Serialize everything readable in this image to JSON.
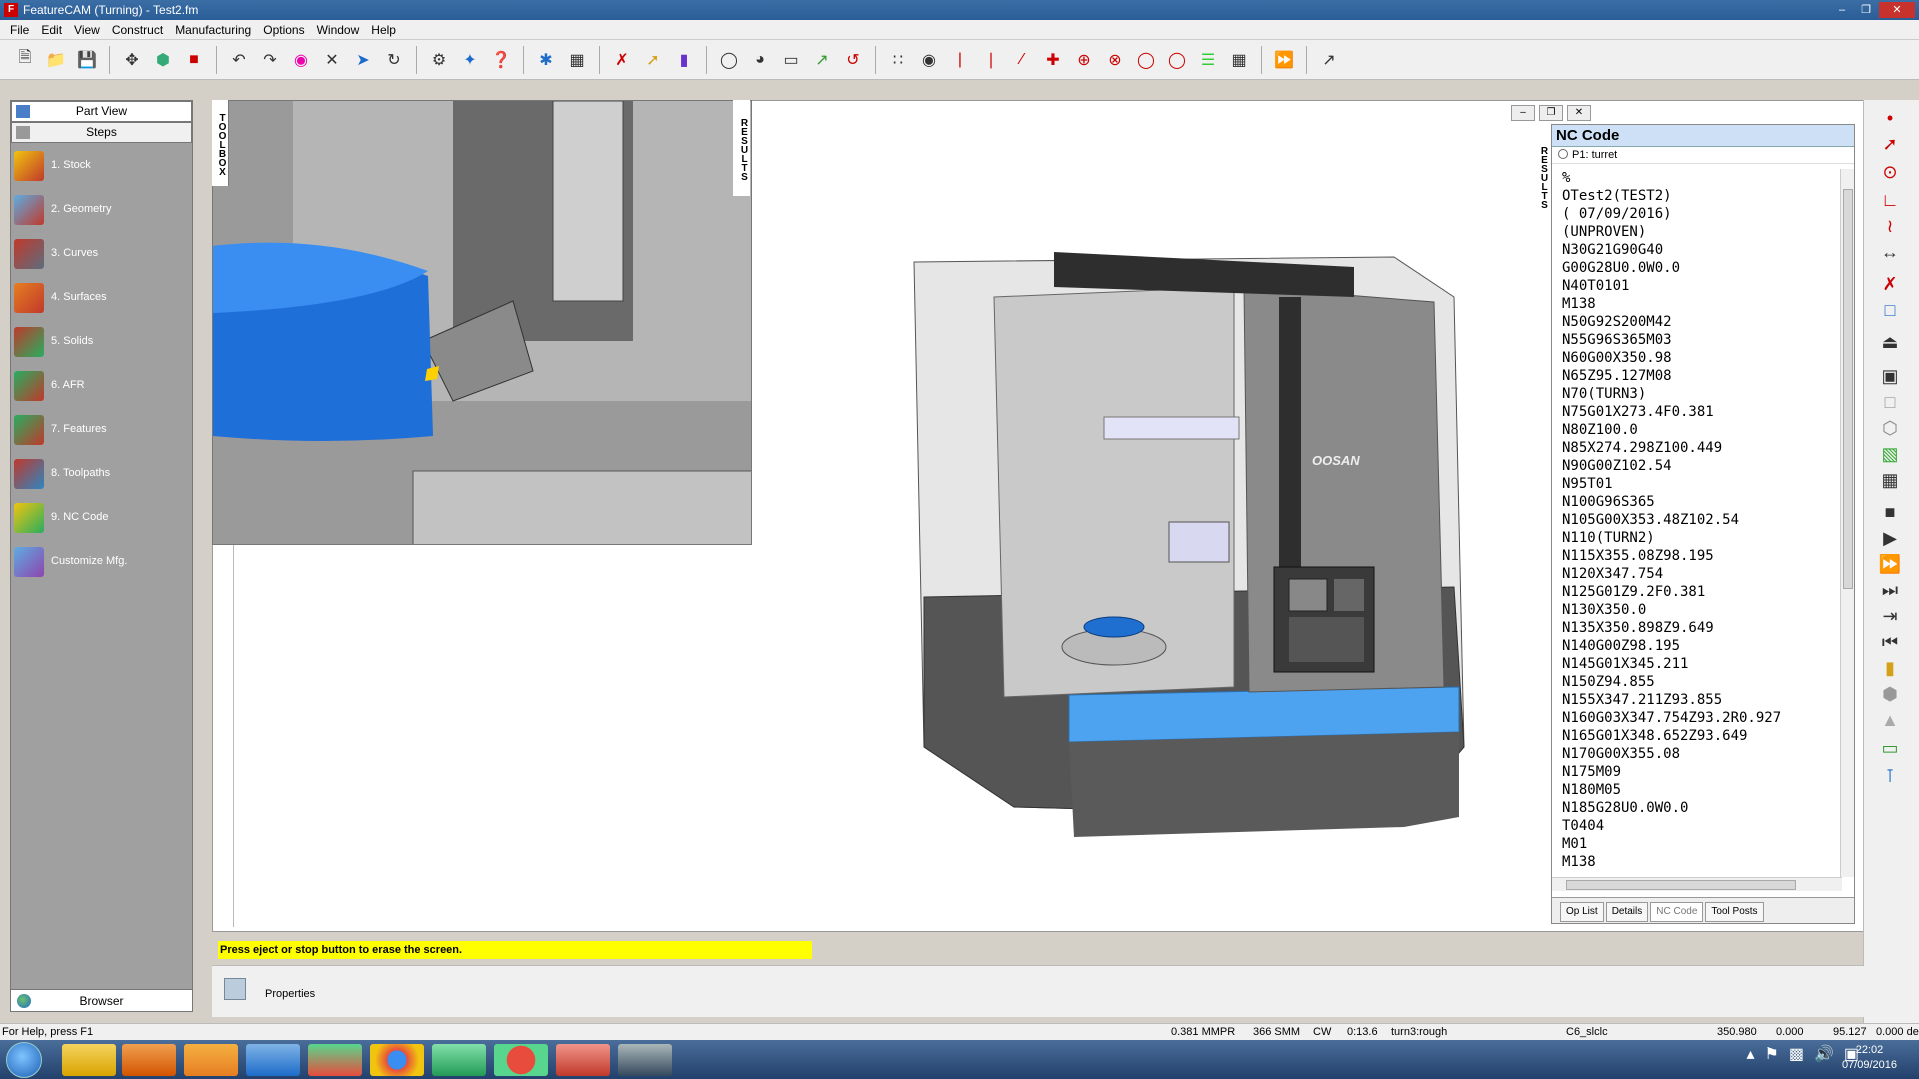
{
  "window": {
    "title": "FeatureCAM (Turning) - Test2.fm"
  },
  "menu": [
    "File",
    "Edit",
    "View",
    "Construct",
    "Manufacturing",
    "Options",
    "Window",
    "Help"
  ],
  "left_panel": {
    "part_view": "Part View",
    "steps": "Steps",
    "items": [
      {
        "label": "1.  Stock",
        "icon": "stock-icon",
        "color": "#d4a017"
      },
      {
        "label": "2.  Geometry",
        "icon": "geometry-icon",
        "color": "#4a7ec9"
      },
      {
        "label": "3.  Curves",
        "icon": "curves-icon",
        "color": "#c0392b"
      },
      {
        "label": "4.  Surfaces",
        "icon": "surfaces-icon",
        "color": "#d35400"
      },
      {
        "label": "5.  Solids",
        "icon": "solids-icon",
        "color": "#27ae60"
      },
      {
        "label": "6.  AFR",
        "icon": "afr-icon",
        "color": "#c0392b"
      },
      {
        "label": "7.  Features",
        "icon": "features-icon",
        "color": "#229954"
      },
      {
        "label": "8.  Toolpaths",
        "icon": "toolpaths-icon",
        "color": "#a93226"
      },
      {
        "label": "9.  NC Code",
        "icon": "nc-code-icon",
        "color": "#f1c40f"
      },
      {
        "label": "Customize Mfg.",
        "icon": "customize-icon",
        "color": "#5d6d7e"
      }
    ],
    "browser": "Browser"
  },
  "toolbox_label": "TOOLBOX",
  "results_label": "RESULTS",
  "nc_panel": {
    "title": "NC Code",
    "turret": "P1: turret",
    "lines": [
      "%",
      "OTest2(TEST2)",
      "( 07/09/2016)",
      "(UNPROVEN)",
      "N30G21G90G40",
      "G00G28U0.0W0.0",
      "N40T0101",
      "M138",
      "N50G92S200M42",
      "N55G96S365M03",
      "N60G00X350.98",
      "N65Z95.127M08",
      "N70(TURN3)",
      "N75G01X273.4F0.381",
      "N80Z100.0",
      "N85X274.298Z100.449",
      "N90G00Z102.54",
      "N95T01",
      "N100G96S365",
      "N105G00X353.48Z102.54",
      "N110(TURN2)",
      "N115X355.08Z98.195",
      "N120X347.754",
      "N125G01Z9.2F0.381",
      "N130X350.0",
      "N135X350.898Z9.649",
      "N140G00Z98.195",
      "N145G01X345.211",
      "N150Z94.855",
      "N155X347.211Z93.855",
      "N160G03X347.754Z93.2R0.927",
      "N165G01X348.652Z93.649",
      "N170G00X355.08",
      "N175M09",
      "N180M05",
      "N185G28U0.0W0.0",
      "T0404",
      "M01",
      "M138"
    ],
    "tabs": [
      "Op List",
      "Details",
      "NC Code",
      "Tool Posts"
    ]
  },
  "machine_brand": "OOSAN",
  "prompt": "Press eject or stop button to erase the screen.",
  "properties": "Properties",
  "status": {
    "help": "For Help, press F1",
    "feed": "0.381 MMPR",
    "speed": "366 SMM",
    "dir": "CW",
    "time": "0:13.6",
    "op": "turn3:rough",
    "tool": "C6_slclc",
    "x": "350.980",
    "y": "0.000",
    "z": "95.127",
    "w": "0.000 de"
  },
  "clock": {
    "time": "22:02",
    "date": "07/09/2016"
  }
}
